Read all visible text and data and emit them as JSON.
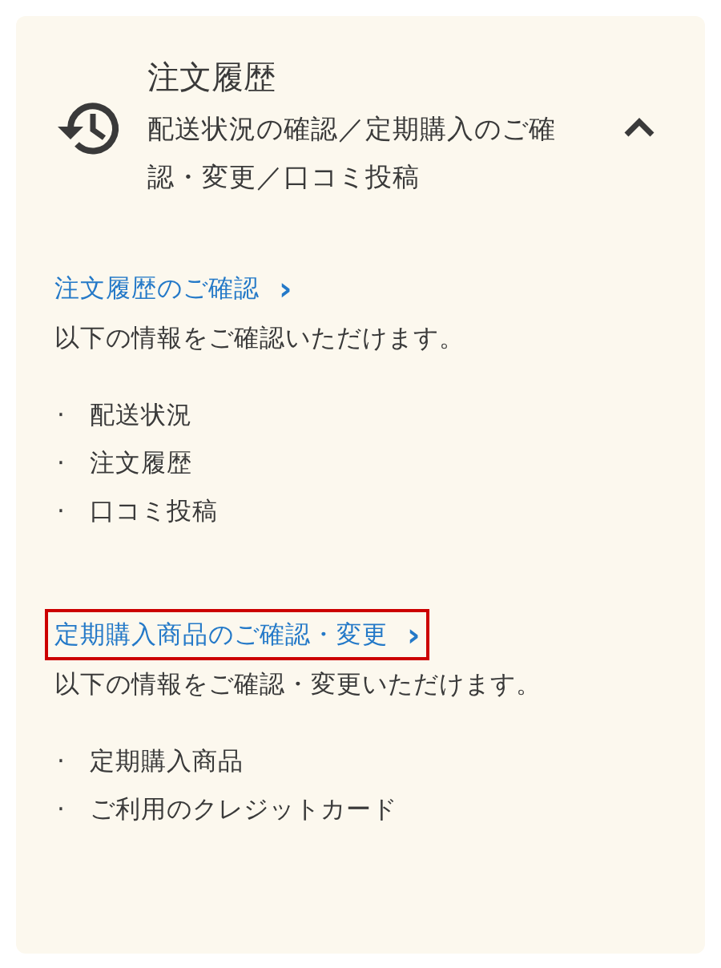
{
  "header": {
    "title": "注文履歴",
    "subtitle": "配送状況の確認／定期購入のご確認・変更／口コミ投稿",
    "expanded": true
  },
  "sections": [
    {
      "link": "注文履歴のご確認",
      "arrow": "›",
      "highlighted": false,
      "description": "以下の情報をご確認いただけます。",
      "items": [
        {
          "marker": "·",
          "text": "配送状況"
        },
        {
          "marker": "·",
          "text": "注文履歴"
        },
        {
          "marker": "·",
          "text": "口コミ投稿"
        }
      ]
    },
    {
      "link": "定期購入商品のご確認・変更",
      "arrow": "›",
      "highlighted": true,
      "description": "以下の情報をご確認・変更いただけます。",
      "items": [
        {
          "marker": "·",
          "text": "定期購入商品"
        },
        {
          "marker": "·",
          "text": "ご利用のクレジットカード"
        }
      ]
    }
  ]
}
